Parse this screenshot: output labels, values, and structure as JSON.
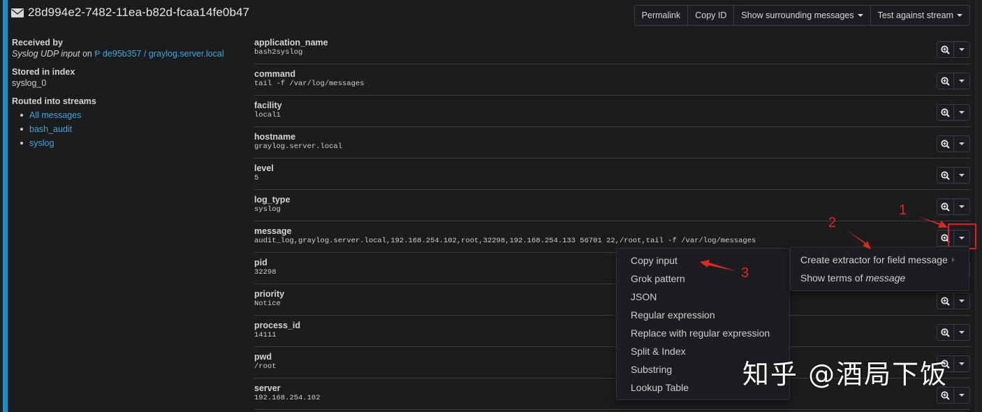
{
  "header": {
    "icon": "envelope-icon",
    "message_id": "28d994e2-7482-11ea-b82d-fcaa14fe0b47"
  },
  "toolbar": {
    "permalink": "Permalink",
    "copy_id": "Copy ID",
    "show_surrounding": "Show surrounding messages",
    "test_against_stream": "Test against stream"
  },
  "meta": {
    "received_by_label": "Received by",
    "input_name": "Syslog UDP input",
    "on_text": "on",
    "node_icon": "node-icon",
    "node_link": "de95b357 / graylog.server.local",
    "stored_label": "Stored in index",
    "index": "syslog_0",
    "routed_label": "Routed into streams",
    "streams": [
      "All messages",
      "bash_audit",
      "syslog"
    ]
  },
  "fields": [
    {
      "name": "application_name",
      "value": "bash2syslog"
    },
    {
      "name": "command",
      "value": "tail -f /var/log/messages"
    },
    {
      "name": "facility",
      "value": "local1"
    },
    {
      "name": "hostname",
      "value": "graylog.server.local"
    },
    {
      "name": "level",
      "value": "5"
    },
    {
      "name": "log_type",
      "value": "syslog"
    },
    {
      "name": "message",
      "value": "audit_log,graylog.server.local,192.168.254.102,root,32298,192.168.254.133 56701 22,/root,tail -f /var/log/messages"
    },
    {
      "name": "pid",
      "value": "32298"
    },
    {
      "name": "priority",
      "value": "Notice"
    },
    {
      "name": "process_id",
      "value": "14111"
    },
    {
      "name": "pwd",
      "value": "/root"
    },
    {
      "name": "server",
      "value": "192.168.254.102"
    }
  ],
  "field_menu": {
    "create_extractor": "Create extractor for field message",
    "show_terms_prefix": "Show terms of",
    "show_terms_field": "message"
  },
  "extractor_menu": [
    "Copy input",
    "Grok pattern",
    "JSON",
    "Regular expression",
    "Replace with regular expression",
    "Split & Index",
    "Substring",
    "Lookup Table"
  ],
  "annotations": {
    "a1": "1",
    "a2": "2",
    "a3": "3",
    "color": "#e0261f"
  },
  "watermark": "知乎 @酒局下饭"
}
